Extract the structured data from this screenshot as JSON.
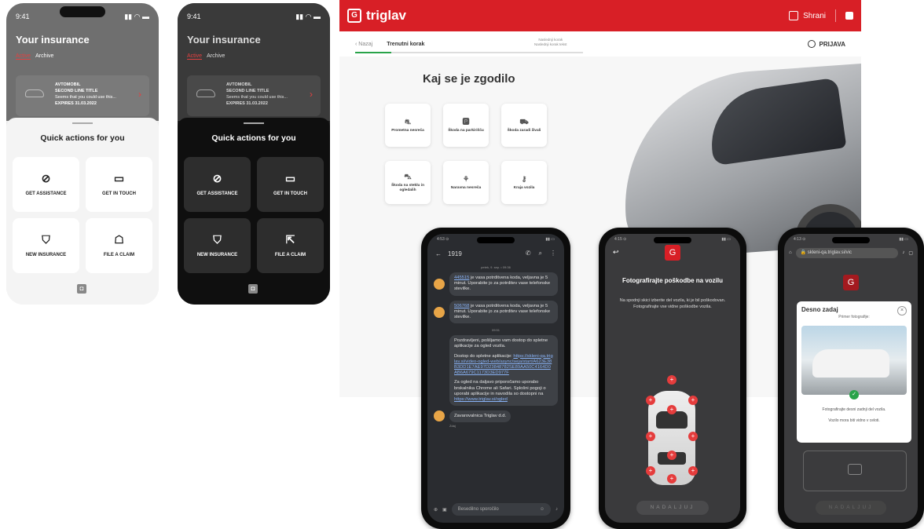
{
  "left_light": {
    "time": "9:41",
    "title": "Your insurance",
    "tab_active": "Active",
    "tab_archive": "Archive",
    "card_line1": "AVTOMOBIL",
    "card_line2": "SECOND LINE TITLE",
    "card_line3": "Seems that you could use this...",
    "card_line4": "EXPIRES 31.03.2022",
    "sheet_title": "Quick actions for you",
    "actions": [
      "GET ASSISTANCE",
      "GET IN TOUCH",
      "NEW INSURANCE",
      "FILE A CLAIM"
    ]
  },
  "left_dark": {
    "time": "9:41",
    "title": "Your insurance",
    "tab_active": "Active",
    "tab_archive": "Archive",
    "card_line1": "AVTOMOBIL",
    "card_line2": "SECOND LINE TITLE",
    "card_line3": "Seems that you could use this...",
    "card_line4": "EXPIRES 31.03.2022",
    "sheet_title": "Quick actions for you",
    "actions": [
      "GET ASSISTANCE",
      "GET IN TOUCH",
      "NEW INSURANCE",
      "FILE A CLAIM"
    ]
  },
  "web": {
    "brand": "triglav",
    "save_label": "Shrani",
    "back_label": "Nazaj",
    "current_step": "Trenutni korak",
    "next_step_1": "Naslednji korak",
    "next_step_2": "Naslednji korak tekst",
    "login_label": "PRIJAVA",
    "heading": "Kaj se je zgodilo",
    "tiles": [
      "Prometna nesreča",
      "Škoda na parkirišču",
      "Škoda zaradi živali",
      "Škoda na steklu in ogledalih",
      "Naravna nesreča",
      "Kraja vozila"
    ],
    "tile_icons": [
      "car-crash-icon",
      "parking-icon",
      "animal-car-icon",
      "windshield-icon",
      "nature-icon",
      "key-icon"
    ]
  },
  "sms": {
    "sender": "1919",
    "date1": "petek, 9. sep. • 09:36",
    "msg1_code": "445515",
    "msg1_text": " je vasa potrditvena koda, veljavna je 5 minut. Uporabite jo za potrditev vase telefonske stevilke.",
    "msg2_code": "506768",
    "msg2_text": " je vasa potrditvena koda, veljavna je 5 minut. Uporabite jo za potrditev vase telefonske stevilke.",
    "time2": "09:51",
    "msg3_p1": "Pozdravljeni, pošiljamo vam dostop do spletne aplikacije za ogled vozila.",
    "msg3_p2": "Dostop do spletne aplikacije: ",
    "msg3_link": "https://skleni-qa.triglav.si/video-ogled-web/async/seja/start/A623E38B3DD1E7AE97D23848782SE89AA50C4164D0AB6A679C1173D3ED977F",
    "msg3_p3": "Za ogled na daljavo priporočamo uporabo brskalnika Chrome ali Safari. Splošni pogoji o uporabi aplikacije in navodila so dostopni na ",
    "msg3_link2": "https://www.triglav.si/ogled",
    "msg4": "Zavarovalnica Triglav d.d.",
    "msg4_time": "Zdaj",
    "input_placeholder": "Besedilno sporočilo"
  },
  "photo_phone": {
    "title": "Fotografirajte poškodbe na vozilu",
    "instruction": "Na spodnji skici izberite del vozila, ki je bil poškodovan. Fotografirajte vse vidne poškodbe vozila.",
    "continue": "NADALJUJ"
  },
  "modal_phone": {
    "url": "skleni-qa.triglav.si/vic",
    "modal_title": "Desno zadaj",
    "modal_sub": "Primer fotografije:",
    "modal_p1": "Fotografirajte desni zadnji del vozila.",
    "modal_p2": "Vozilo mora biti vidno v celoti.",
    "continue": "NADALJUJ"
  },
  "colors": {
    "brand_red": "#d81f26",
    "accent_green": "#2aa34a"
  }
}
